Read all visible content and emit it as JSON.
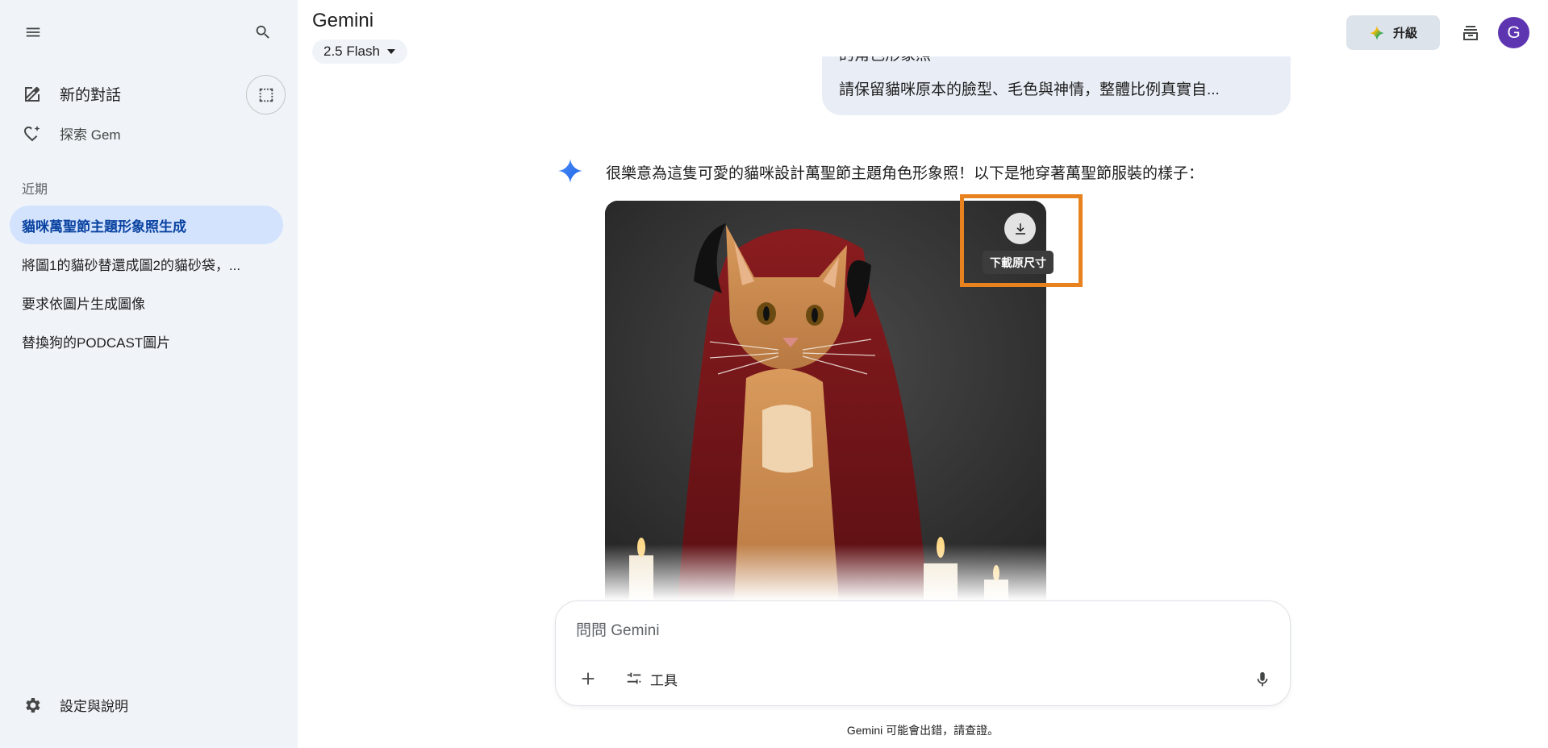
{
  "app": {
    "title": "Gemini",
    "model": "2.5 Flash"
  },
  "sidebar": {
    "new_chat": "新的對話",
    "explore_gem": "探索 Gem",
    "recent_heading": "近期",
    "chats": [
      {
        "label": "貓咪萬聖節主題形象照生成",
        "active": true
      },
      {
        "label": "將圖1的貓砂替還成圖2的貓砂袋，...",
        "active": false
      },
      {
        "label": "要求依圖片生成圖像",
        "active": false
      },
      {
        "label": "替換狗的PODCAST圖片",
        "active": false
      }
    ],
    "settings": "設定與說明"
  },
  "header": {
    "upgrade_label": "升級",
    "avatar_initial": "G"
  },
  "conversation": {
    "user_message_partial": "的角色形象照",
    "user_message": "請保留貓咪原本的臉型、毛色與神情，整體比例真實自...",
    "response_text": "很樂意為這隻可愛的貓咪設計萬聖節主題角色形象照！以下是牠穿著萬聖節服裝的樣子：",
    "download_tooltip": "下載原尺寸"
  },
  "input": {
    "placeholder": "問問 Gemini",
    "value": "",
    "tools_label": "工具"
  },
  "footer": {
    "disclaimer": "Gemini 可能會出錯，請查證。"
  },
  "colors": {
    "sidebar_bg": "#f0f4f9",
    "active_chat_bg": "#d3e3fd",
    "active_chat_text": "#0842a0",
    "highlight_border": "#e8821e",
    "avatar_bg": "#5e35b1"
  }
}
